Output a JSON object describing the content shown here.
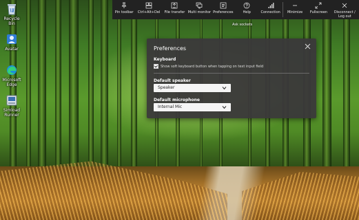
{
  "desktop": {
    "icons": [
      {
        "label": "Recycle Bin",
        "icon": "recycle-bin-icon"
      },
      {
        "label": "Avatar",
        "icon": "avatar-icon"
      },
      {
        "label": "Microsoft Edge",
        "icon": "edge-icon"
      },
      {
        "label": "Simload Runner",
        "icon": "simload-icon"
      }
    ]
  },
  "toolbar": {
    "items": [
      {
        "label": "Pin toolbar",
        "icon": "pin-icon"
      },
      {
        "label": "Ctrl+Alt+Del",
        "icon": "keyboard-icon"
      },
      {
        "label": "File transfer",
        "icon": "file-transfer-icon"
      },
      {
        "label": "Multi monitor",
        "icon": "multi-monitor-icon"
      },
      {
        "label": "Preferences",
        "icon": "preferences-icon"
      },
      {
        "label": "Help",
        "icon": "help-icon"
      },
      {
        "label": "Connection",
        "icon": "connection-icon"
      },
      {
        "label": "Minimize",
        "icon": "minimize-icon"
      },
      {
        "label": "Fullscreen",
        "icon": "fullscreen-icon"
      },
      {
        "label": "Disconnect / Log out",
        "icon": "close-icon"
      }
    ],
    "under_label": "Ask sockets"
  },
  "dialog": {
    "title": "Preferences",
    "keyboard": {
      "heading": "Keyboard",
      "checkbox_label": "Show soft keyboard button when tapping on text input field",
      "checked": true
    },
    "speaker": {
      "heading": "Default speaker",
      "value": "Speaker"
    },
    "microphone": {
      "heading": "Default microphone",
      "value": "Internal Mic"
    }
  }
}
